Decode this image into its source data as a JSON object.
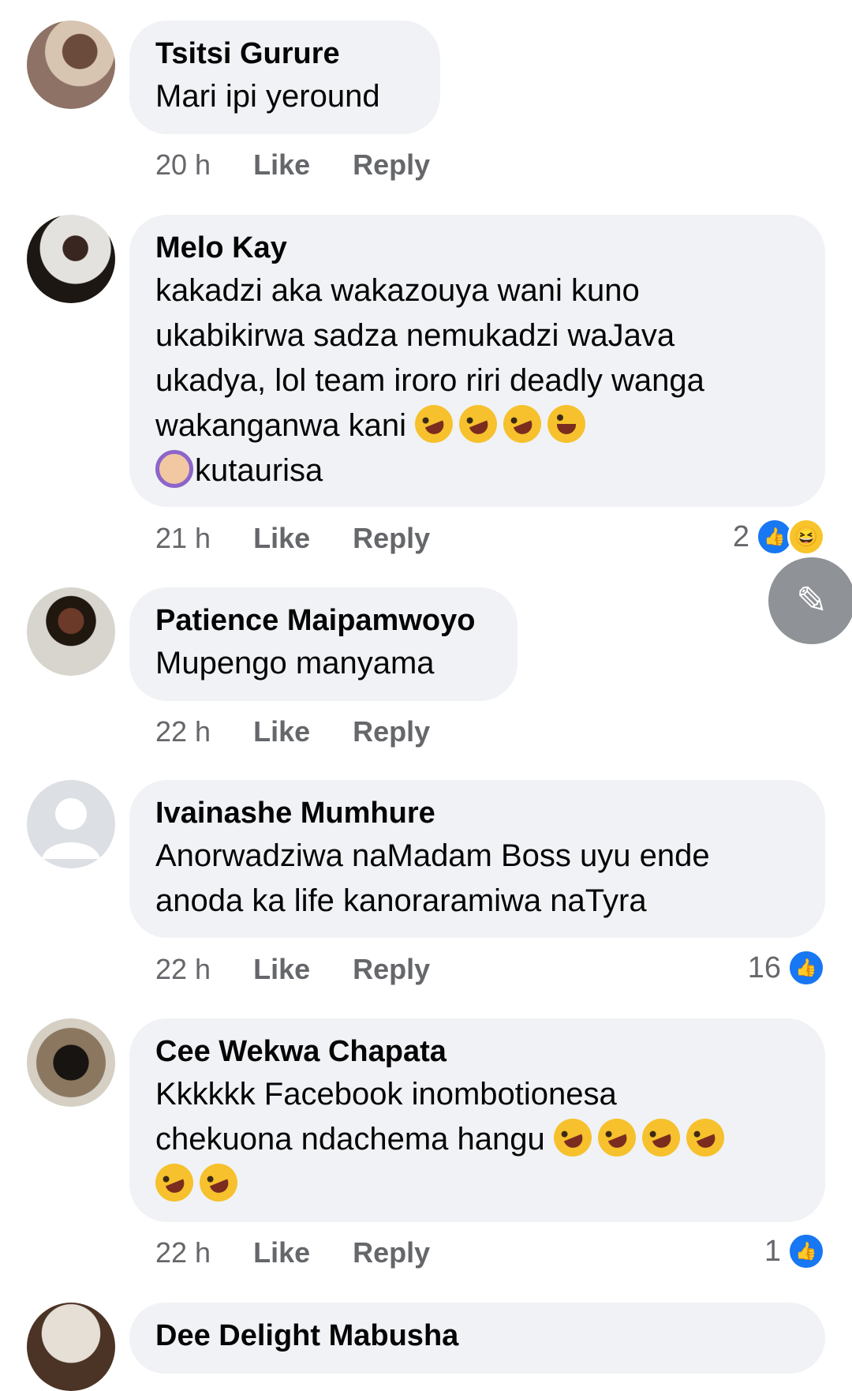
{
  "comments": [
    {
      "author": "Tsitsi Gurure",
      "text": "Mari ipi yeround",
      "time": "20 h",
      "like": "Like",
      "reply": "Reply",
      "reactions": ""
    },
    {
      "author": "Melo Kay",
      "text_lines": [
        "kakadzi aka wakazouya wani kuno",
        "ukabikirwa sadza nemukadzi waJava",
        "ukadya, lol team iroro riri deadly wanga",
        "wakanganwa kani",
        "kutaurisa"
      ],
      "time": "21 h",
      "like": "Like",
      "reply": "Reply",
      "reactions": "2"
    },
    {
      "author": "Patience Maipamwoyo",
      "text": "Mupengo manyama",
      "time": "22 h",
      "like": "Like",
      "reply": "Reply",
      "reactions": ""
    },
    {
      "author": "Ivainashe Mumhure",
      "text_lines": [
        "Anorwadziwa naMadam Boss uyu ende",
        "anoda ka life kanoraramiwa naTyra"
      ],
      "time": "22 h",
      "like": "Like",
      "reply": "Reply",
      "reactions": "16"
    },
    {
      "author": "Cee Wekwa Chapata",
      "text_lines": [
        "Kkkkkk Facebook inombotionesa",
        "chekuona ndachema hangu"
      ],
      "time": "22 h",
      "like": "Like",
      "reply": "Reply",
      "reactions": "1"
    },
    {
      "author": "Dee Delight Mabusha"
    }
  ],
  "icons": {
    "like": "thumbs-up-icon",
    "haha": "laughing-face-icon",
    "edit": "pencil-icon"
  },
  "colors": {
    "like_blue": "#1877f2",
    "bubble": "#f0f2f5",
    "meta": "#65676b"
  }
}
